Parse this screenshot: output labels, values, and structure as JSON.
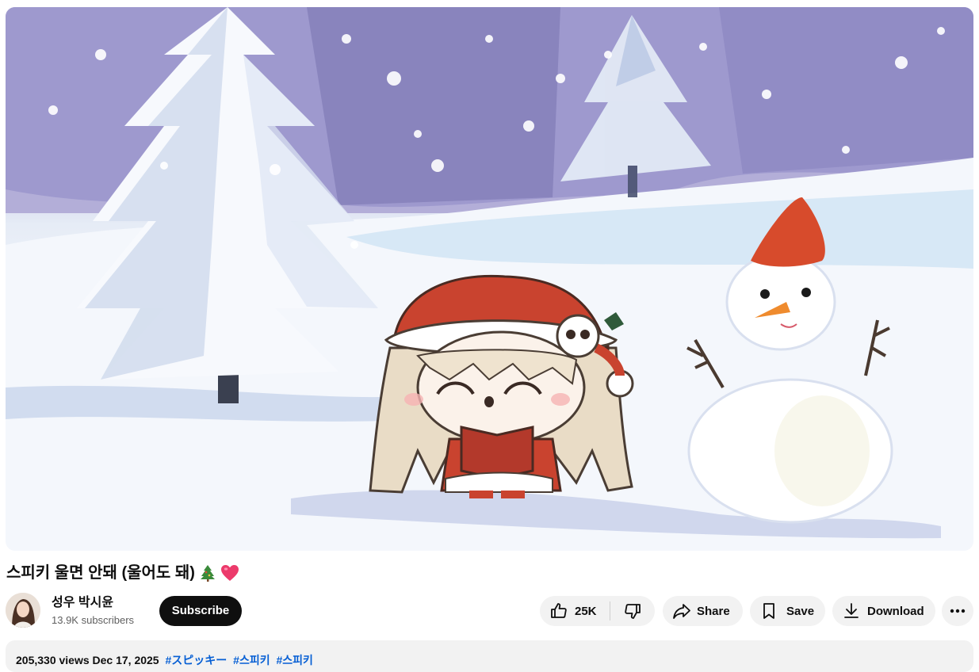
{
  "video": {
    "title": "스피키 울면 안돼 (울어도 돼)",
    "title_emojis": [
      "christmas-tree",
      "heart"
    ]
  },
  "channel": {
    "name": "성우 박시윤",
    "subscribers": "13.9K subscribers",
    "subscribe_label": "Subscribe"
  },
  "actions": {
    "like_count": "25K",
    "share_label": "Share",
    "save_label": "Save",
    "download_label": "Download",
    "icons": [
      "thumb-up-icon",
      "thumb-down-icon",
      "share-arrow-icon",
      "bookmark-icon",
      "download-icon",
      "more-horiz-icon"
    ]
  },
  "description": {
    "meta": "205,330 views  Dec 17, 2025",
    "tags": [
      "#スピッキー",
      "#스피키",
      "#스피키"
    ]
  },
  "colors": {
    "subscribe_bg": "#0f0f0f",
    "pill_bg": "#f2f2f2",
    "hashtag": "#065fd4"
  }
}
